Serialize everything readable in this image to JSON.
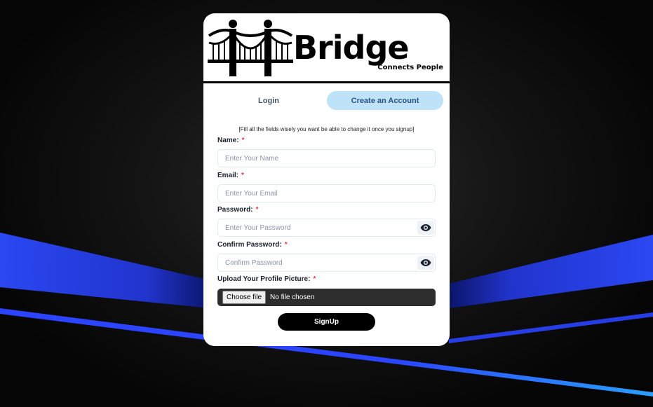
{
  "brand": {
    "name": "Bridge",
    "tagline": "Connects People"
  },
  "tabs": [
    {
      "label": "Login",
      "active": false
    },
    {
      "label": "Create an Account",
      "active": true
    }
  ],
  "form": {
    "hint": "[Fill all the fields wisely you want be able to change it once you signup]",
    "required_mark": "*",
    "name": {
      "label": "Name:",
      "placeholder": "Enter Your Name",
      "value": ""
    },
    "email": {
      "label": "Email:",
      "placeholder": "Enter Your Email",
      "value": ""
    },
    "password": {
      "label": "Password:",
      "placeholder": "Enter Your Password",
      "value": ""
    },
    "confirm_password": {
      "label": "Confirm Password:",
      "placeholder": "Confirm Password",
      "value": ""
    },
    "picture": {
      "label": "Upload Your Profile Picture:",
      "button_label": "Choose file",
      "status": "No file chosen"
    },
    "submit_label": "SignUp"
  },
  "colors": {
    "active_tab_bg": "#bee3f8",
    "active_tab_text": "#2c5282",
    "required": "#e53e3e",
    "accent_blue": "#2f4dff"
  },
  "icons": {
    "logo": "bridge-logo-icon",
    "password_toggle": "eye-icon"
  }
}
